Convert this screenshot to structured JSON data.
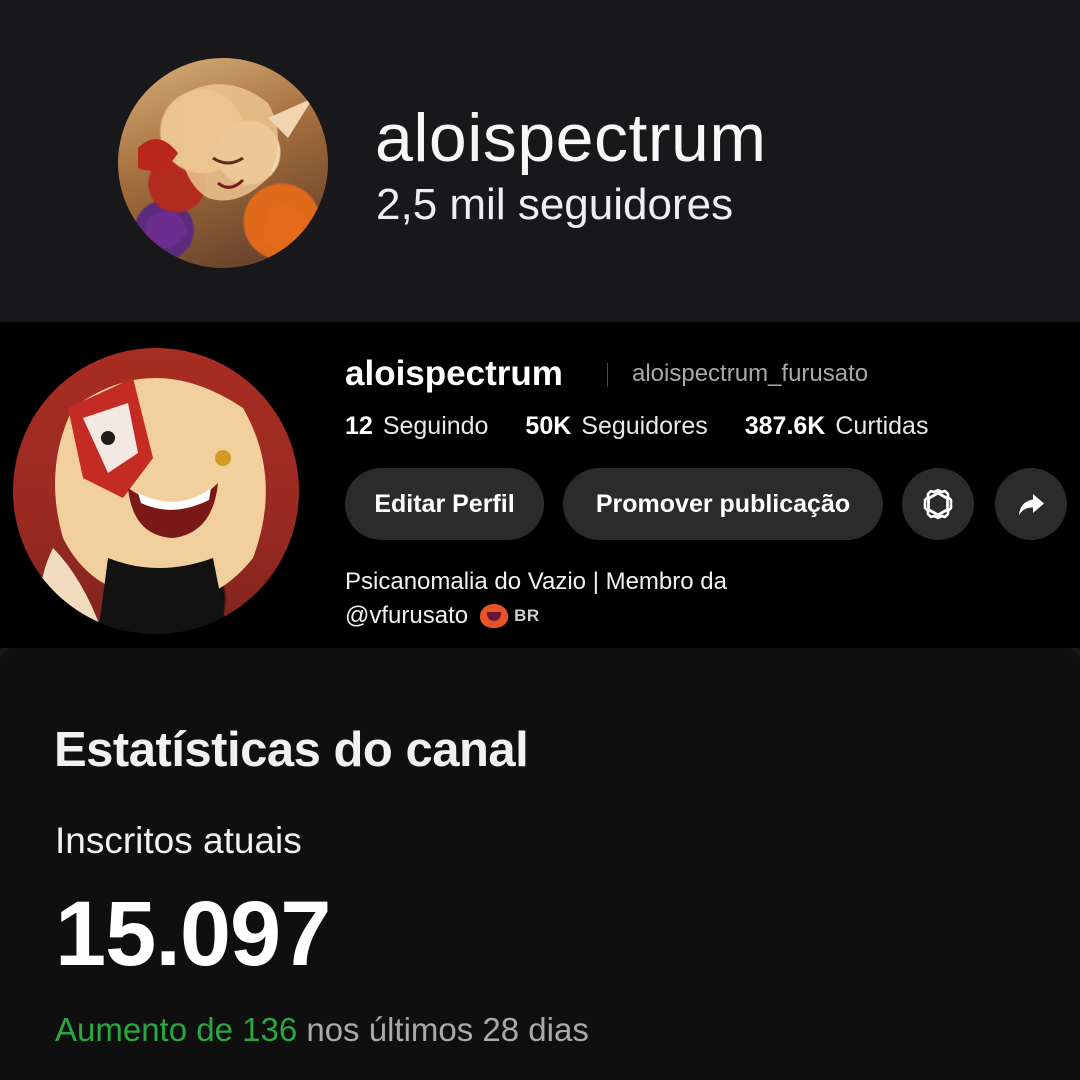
{
  "twitch": {
    "username": "aloispectrum",
    "followers": "2,5 mil seguidores"
  },
  "tiktok": {
    "username": "aloispectrum",
    "handle": "aloispectrum_furusato",
    "stats": [
      {
        "value": "12",
        "label": "Seguindo"
      },
      {
        "value": "50K",
        "label": "Seguidores"
      },
      {
        "value": "387.6K",
        "label": "Curtidas"
      }
    ],
    "buttons": {
      "edit": "Editar Perfil",
      "promote": "Promover publicação"
    },
    "icons": {
      "settings": "gear-icon",
      "share": "share-arrow-icon",
      "emoji": "devil-emoji-icon"
    },
    "bio_line1": "Psicanomalia do Vazio | Membro da",
    "bio_line2": "@vfurusato",
    "bio_region": "BR"
  },
  "youtube": {
    "title": "Estatísticas do canal",
    "metric_label": "Inscritos atuais",
    "metric_value": "15.097",
    "change_highlight": "Aumento de 136",
    "change_rest": " nos últimos 28 dias",
    "colors": {
      "highlight": "#2ba640"
    }
  }
}
